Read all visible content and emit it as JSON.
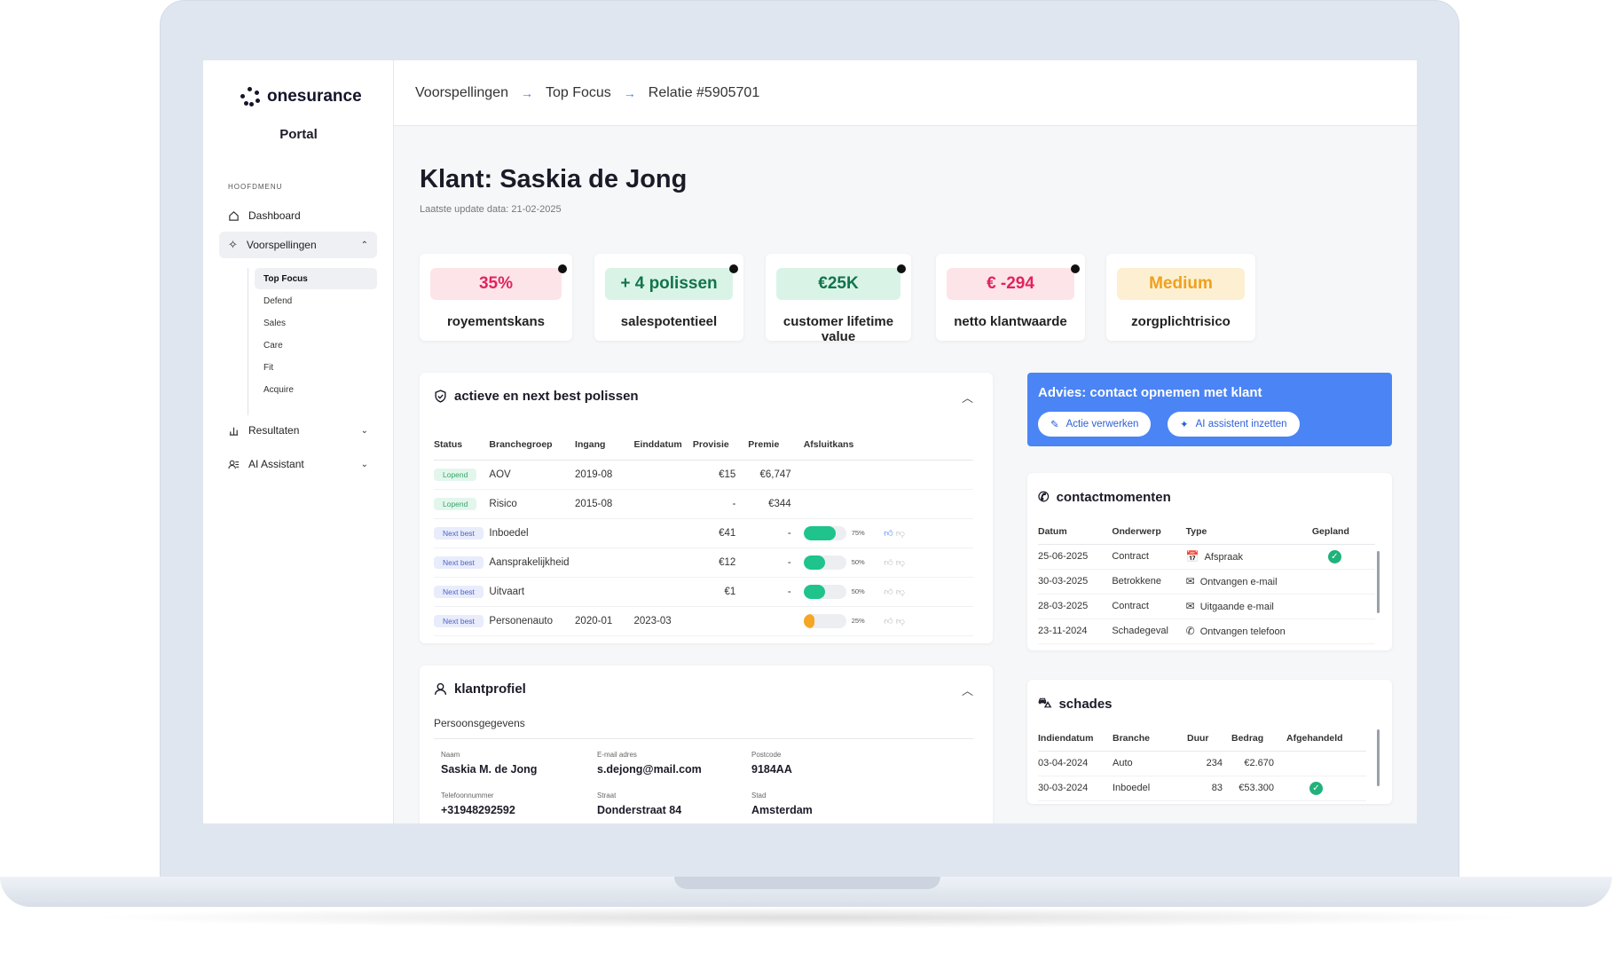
{
  "brand": {
    "name": "onesurance",
    "portal": "Portal"
  },
  "sidebar": {
    "menu_heading": "HOOFDMENU",
    "items": [
      {
        "label": "Dashboard",
        "icon": "home-icon"
      },
      {
        "label": "Voorspellingen",
        "icon": "sparkle-icon",
        "chevron": "⌃"
      },
      {
        "label": "Resultaten",
        "icon": "chart-icon",
        "chevron": "⌄"
      },
      {
        "label": "AI Assistant",
        "icon": "assistant-icon",
        "chevron": "⌄"
      }
    ],
    "subitems": [
      "Top Focus",
      "Defend",
      "Sales",
      "Care",
      "Fit",
      "Acquire"
    ]
  },
  "breadcrumb": [
    "Voorspellingen",
    "Top Focus",
    "Relatie #5905701"
  ],
  "page": {
    "title": "Klant: Saskia de Jong",
    "subtitle": "Laatste update data: 21-02-2025"
  },
  "kpis": [
    {
      "value": "35%",
      "label": "royementskans",
      "bg": "#fde4e8",
      "color": "#e0245e",
      "info": true
    },
    {
      "value": "+ 4 polissen",
      "label": "salespotentieel",
      "bg": "#d9f4e7",
      "color": "#13744b",
      "info": true
    },
    {
      "value": "€25K",
      "label": "customer lifetime value",
      "bg": "#d9f4e7",
      "color": "#13744b",
      "info": true
    },
    {
      "value": "€ -294",
      "label": "netto klantwaarde",
      "bg": "#fde4e8",
      "color": "#e0245e",
      "info": true
    },
    {
      "value": "Medium",
      "label": "zorgplichtrisico",
      "bg": "#fdf0d2",
      "color": "#f0a01c",
      "info": false
    }
  ],
  "policies": {
    "title": "actieve en next best polissen",
    "columns": [
      "Status",
      "Branchegroep",
      "Ingang",
      "Einddatum",
      "Provisie",
      "Premie",
      "Afsluitkans"
    ],
    "rows": [
      {
        "status": "Lopend",
        "type": "lop",
        "branch": "AOV",
        "start": "2019-08",
        "end": "",
        "provisie": "€15",
        "premie": "€6,747",
        "kans": null,
        "pct": ""
      },
      {
        "status": "Lopend",
        "type": "lop",
        "branch": "Risico",
        "start": "2015-08",
        "end": "",
        "provisie": "-",
        "premie": "€344",
        "kans": null,
        "pct": ""
      },
      {
        "status": "Next best",
        "type": "nb",
        "branch": "Inboedel",
        "start": "",
        "end": "",
        "provisie": "€41",
        "premie": "-",
        "kans": 0.75,
        "pct": "75%",
        "color": "#1ec48b",
        "liked": true
      },
      {
        "status": "Next best",
        "type": "nb",
        "branch": "Aansprakelijkheid",
        "start": "",
        "end": "",
        "provisie": "€12",
        "premie": "-",
        "kans": 0.5,
        "pct": "50%",
        "color": "#1ec48b",
        "liked": false
      },
      {
        "status": "Next best",
        "type": "nb",
        "branch": "Uitvaart",
        "start": "",
        "end": "",
        "provisie": "€1",
        "premie": "-",
        "kans": 0.5,
        "pct": "50%",
        "color": "#1ec48b",
        "liked": false
      },
      {
        "status": "Next best",
        "type": "nb",
        "branch": "Personenauto",
        "start": "2020-01",
        "end": "2023-03",
        "provisie": "",
        "premie": "",
        "kans": 0.25,
        "pct": "25%",
        "color": "#f5a623",
        "liked": false
      }
    ]
  },
  "advice": {
    "title": "Advies: contact opnemen met klant",
    "btn1": "Actie verwerken",
    "btn2": "AI assistent inzetten"
  },
  "contacts": {
    "title": "contactmomenten",
    "columns": [
      "Datum",
      "Onderwerp",
      "Type",
      "Gepland"
    ],
    "rows": [
      {
        "date": "25-06-2025",
        "subject": "Contract",
        "type": "Afspraak",
        "icon": "calendar-icon",
        "glyph": "📅",
        "planned": true
      },
      {
        "date": "30-03-2025",
        "subject": "Betrokkene",
        "type": "Ontvangen e-mail",
        "icon": "mail-in-icon",
        "glyph": "✉",
        "planned": false
      },
      {
        "date": "28-03-2025",
        "subject": "Contract",
        "type": "Uitgaande e-mail",
        "icon": "mail-out-icon",
        "glyph": "✉",
        "planned": false
      },
      {
        "date": "23-11-2024",
        "subject": "Schadegeval",
        "type": "Ontvangen telefoon",
        "icon": "phone-in-icon",
        "glyph": "✆",
        "planned": false
      }
    ]
  },
  "claims": {
    "title": "schades",
    "columns": [
      "Indiendatum",
      "Branche",
      "Duur",
      "Bedrag",
      "Afgehandeld"
    ],
    "rows": [
      {
        "date": "03-04-2024",
        "branch": "Auto",
        "duration": "234",
        "amount": "€2.670",
        "done": false
      },
      {
        "date": "30-03-2024",
        "branch": "Inboedel",
        "duration": "83",
        "amount": "€53.300",
        "done": true
      }
    ]
  },
  "profile": {
    "title": "klantprofiel",
    "section": "Persoonsgegevens",
    "fields": [
      {
        "label": "Naam",
        "value": "Saskia M. de Jong"
      },
      {
        "label": "E-mail adres",
        "value": "s.dejong@mail.com"
      },
      {
        "label": "Postcode",
        "value": "9184AA"
      },
      {
        "label": "Telefoonnummer",
        "value": "+31948292592"
      },
      {
        "label": "Straat",
        "value": "Donderstraat 84"
      },
      {
        "label": "Stad",
        "value": "Amsterdam"
      }
    ]
  },
  "colors": {
    "accent": "#4b84f4",
    "success": "#20b27a",
    "danger": "#e0245e",
    "warning": "#f0a01c"
  }
}
